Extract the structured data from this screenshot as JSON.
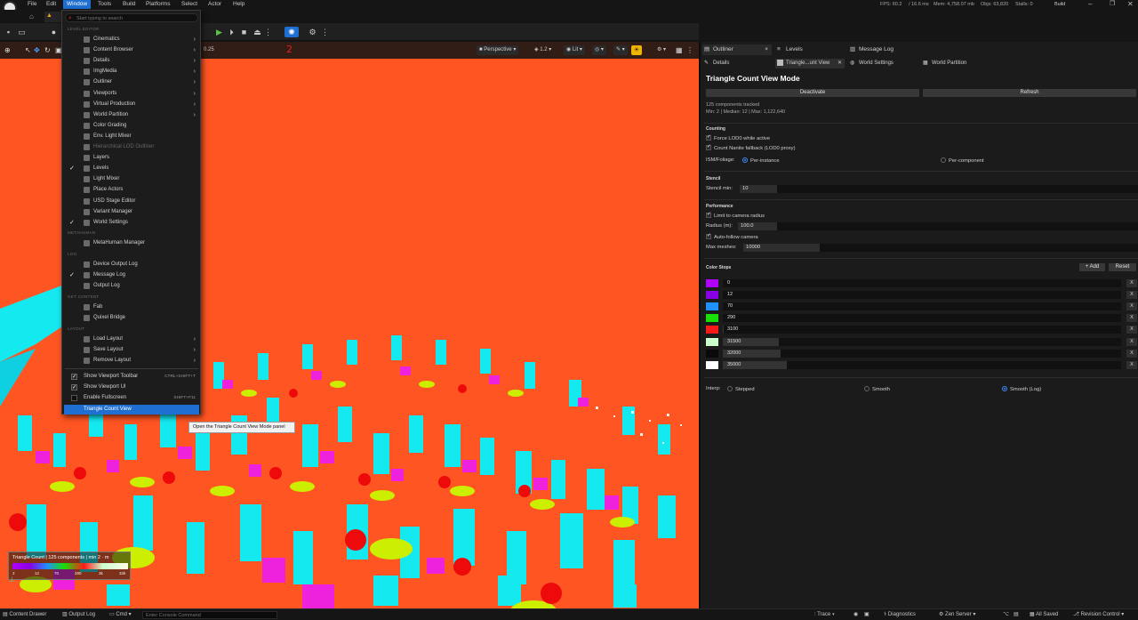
{
  "menubar": {
    "items": [
      "File",
      "Edit",
      "Window",
      "Tools",
      "Build",
      "Platforms",
      "Select",
      "Actor",
      "Help"
    ],
    "active": "Window",
    "stats": {
      "fps": "FPS: 60.2",
      "ms": "/  16.6 ms",
      "mem": "Mem: 4,758.07 mb",
      "objs": "Objs: 63,820",
      "stalls": "Stalls: 0"
    },
    "build_label": "Build"
  },
  "toolbar": {
    "speed_value": "0.25",
    "red_annotation": "2"
  },
  "viewport": {
    "perspective_label": "Perspective",
    "fov_label": "1.2",
    "lit_label": "Lit"
  },
  "legend": {
    "title": "Triangle Count  |  125 components  |  min 2 · m",
    "ticks": [
      "2",
      "12",
      "70",
      "290",
      "3k",
      "32k"
    ],
    "gradient_colors": [
      "#b000ff",
      "#8a00e6",
      "#1e90ff",
      "#18e000",
      "#ff1a1a",
      "#ccffcc",
      "#fffbe6"
    ]
  },
  "window_menu": {
    "search_placeholder": "Start typing to search",
    "sections": {
      "level_editor": "LEVEL EDITOR",
      "metahuman": "METAHUMAN",
      "log": "LOG",
      "get_content": "GET CONTENT",
      "layout": "LAYOUT"
    },
    "level_editor_items": [
      {
        "label": "Cinematics",
        "submenu": true,
        "checked": false,
        "disabled": false
      },
      {
        "label": "Content Browser",
        "submenu": true,
        "checked": false,
        "disabled": false
      },
      {
        "label": "Details",
        "submenu": true,
        "checked": false,
        "disabled": false
      },
      {
        "label": "ImgMedia",
        "submenu": true,
        "checked": false,
        "disabled": false
      },
      {
        "label": "Outliner",
        "submenu": true,
        "checked": false,
        "disabled": false
      },
      {
        "label": "Viewports",
        "submenu": true,
        "checked": false,
        "disabled": false
      },
      {
        "label": "Virtual Production",
        "submenu": true,
        "checked": false,
        "disabled": false
      },
      {
        "label": "World Partition",
        "submenu": true,
        "checked": false,
        "disabled": false
      },
      {
        "label": "Color Grading",
        "submenu": false,
        "checked": false,
        "disabled": false
      },
      {
        "label": "Env. Light Mixer",
        "submenu": false,
        "checked": false,
        "disabled": false
      },
      {
        "label": "Hierarchical LOD Outliner",
        "submenu": false,
        "checked": false,
        "disabled": true
      },
      {
        "label": "Layers",
        "submenu": false,
        "checked": false,
        "disabled": false
      },
      {
        "label": "Levels",
        "submenu": false,
        "checked": true,
        "disabled": false
      },
      {
        "label": "Light Mixer",
        "submenu": false,
        "checked": false,
        "disabled": false
      },
      {
        "label": "Place Actors",
        "submenu": false,
        "checked": false,
        "disabled": false
      },
      {
        "label": "USD Stage Editor",
        "submenu": false,
        "checked": false,
        "disabled": false
      },
      {
        "label": "Variant Manager",
        "submenu": false,
        "checked": false,
        "disabled": false
      },
      {
        "label": "World Settings",
        "submenu": false,
        "checked": true,
        "disabled": false
      }
    ],
    "metahuman_items": [
      {
        "label": "MetaHuman Manager"
      }
    ],
    "log_items": [
      {
        "label": "Device Output Log",
        "checked": false
      },
      {
        "label": "Message Log",
        "checked": true
      },
      {
        "label": "Output Log",
        "checked": false
      }
    ],
    "content_items": [
      {
        "label": "Fab"
      },
      {
        "label": "Quixel Bridge"
      }
    ],
    "layout_items": [
      {
        "label": "Load Layout"
      },
      {
        "label": "Save Layout"
      },
      {
        "label": "Remove Layout"
      }
    ],
    "toggle_items": [
      {
        "label": "Show Viewport Toolbar",
        "shortcut": "CTRL+SHIFT+T",
        "checked": true
      },
      {
        "label": "Show Viewport UI",
        "shortcut": "",
        "checked": true
      },
      {
        "label": "Enable Fullscreen",
        "shortcut": "SHIFT+F11",
        "checked": false
      }
    ],
    "highlighted_item": "Triangle Count View",
    "tooltip": "Open the Triangle Count View Mode panel"
  },
  "right_panel": {
    "tabs": [
      "Outliner",
      "Levels",
      "Message Log"
    ],
    "subtabs": [
      "Details",
      "Triangle...unt View",
      "World Settings",
      "World Partition"
    ],
    "title": "Triangle Count View Mode",
    "deactivate_label": "Deactivate",
    "refresh_label": "Refresh",
    "summary_line1": "125 components tracked",
    "summary_line2": "Min: 2 | Median: 12 | Max: 1,122,640",
    "counting": {
      "header": "Counting",
      "force_lod0": "Force LOD0 while active",
      "count_nanite": "Count Nanite fallback (LOD0 proxy)",
      "ism_label": "ISM/Foliage:",
      "per_instance": "Per-instance",
      "per_component": "Per-component"
    },
    "stencil": {
      "header": "Stencil",
      "min_label": "Stencil min:",
      "min_value": "10"
    },
    "performance": {
      "header": "Performance",
      "limit_radius": "Limit to camera radius",
      "radius_label": "Radius (m):",
      "radius_value": "100.0",
      "auto_follow": "Auto-follow camera",
      "max_meshes_label": "Max meshes:",
      "max_meshes_value": "10000"
    },
    "color_stops": {
      "header": "Color Stops",
      "add_label": "+ Add",
      "reset_label": "Reset",
      "remove_label": "X",
      "stops": [
        {
          "color": "#b000ff",
          "value": "0",
          "fill": 0.0
        },
        {
          "color": "#8a00e6",
          "value": "12",
          "fill": 0.0
        },
        {
          "color": "#1e90ff",
          "value": "70",
          "fill": 0.0
        },
        {
          "color": "#18e000",
          "value": "290",
          "fill": 0.0
        },
        {
          "color": "#ff1a1a",
          "value": "3100",
          "fill": 0.002
        },
        {
          "color": "#ccffcc",
          "value": "31500",
          "fill": 0.14
        },
        {
          "color": "#0a0a0a",
          "value": "32000",
          "fill": 0.145
        },
        {
          "color": "#ffffff",
          "value": "35000",
          "fill": 0.16
        }
      ]
    },
    "interp": {
      "label": "Interp:",
      "stepped": "Stepped",
      "smooth": "Smooth",
      "smooth_log": "Smooth (Log)",
      "selected": "Smooth (Log)"
    }
  },
  "statusbar": {
    "content_drawer": "Content Drawer",
    "output_log": "Output Log",
    "cmd": "Cmd",
    "console_placeholder": "Enter Console Command",
    "trace": "Trace",
    "diagnostics": "Diagnostics",
    "zen_server": "Zen Server",
    "all_saved": "All Saved",
    "revision_control": "Revision Control"
  }
}
